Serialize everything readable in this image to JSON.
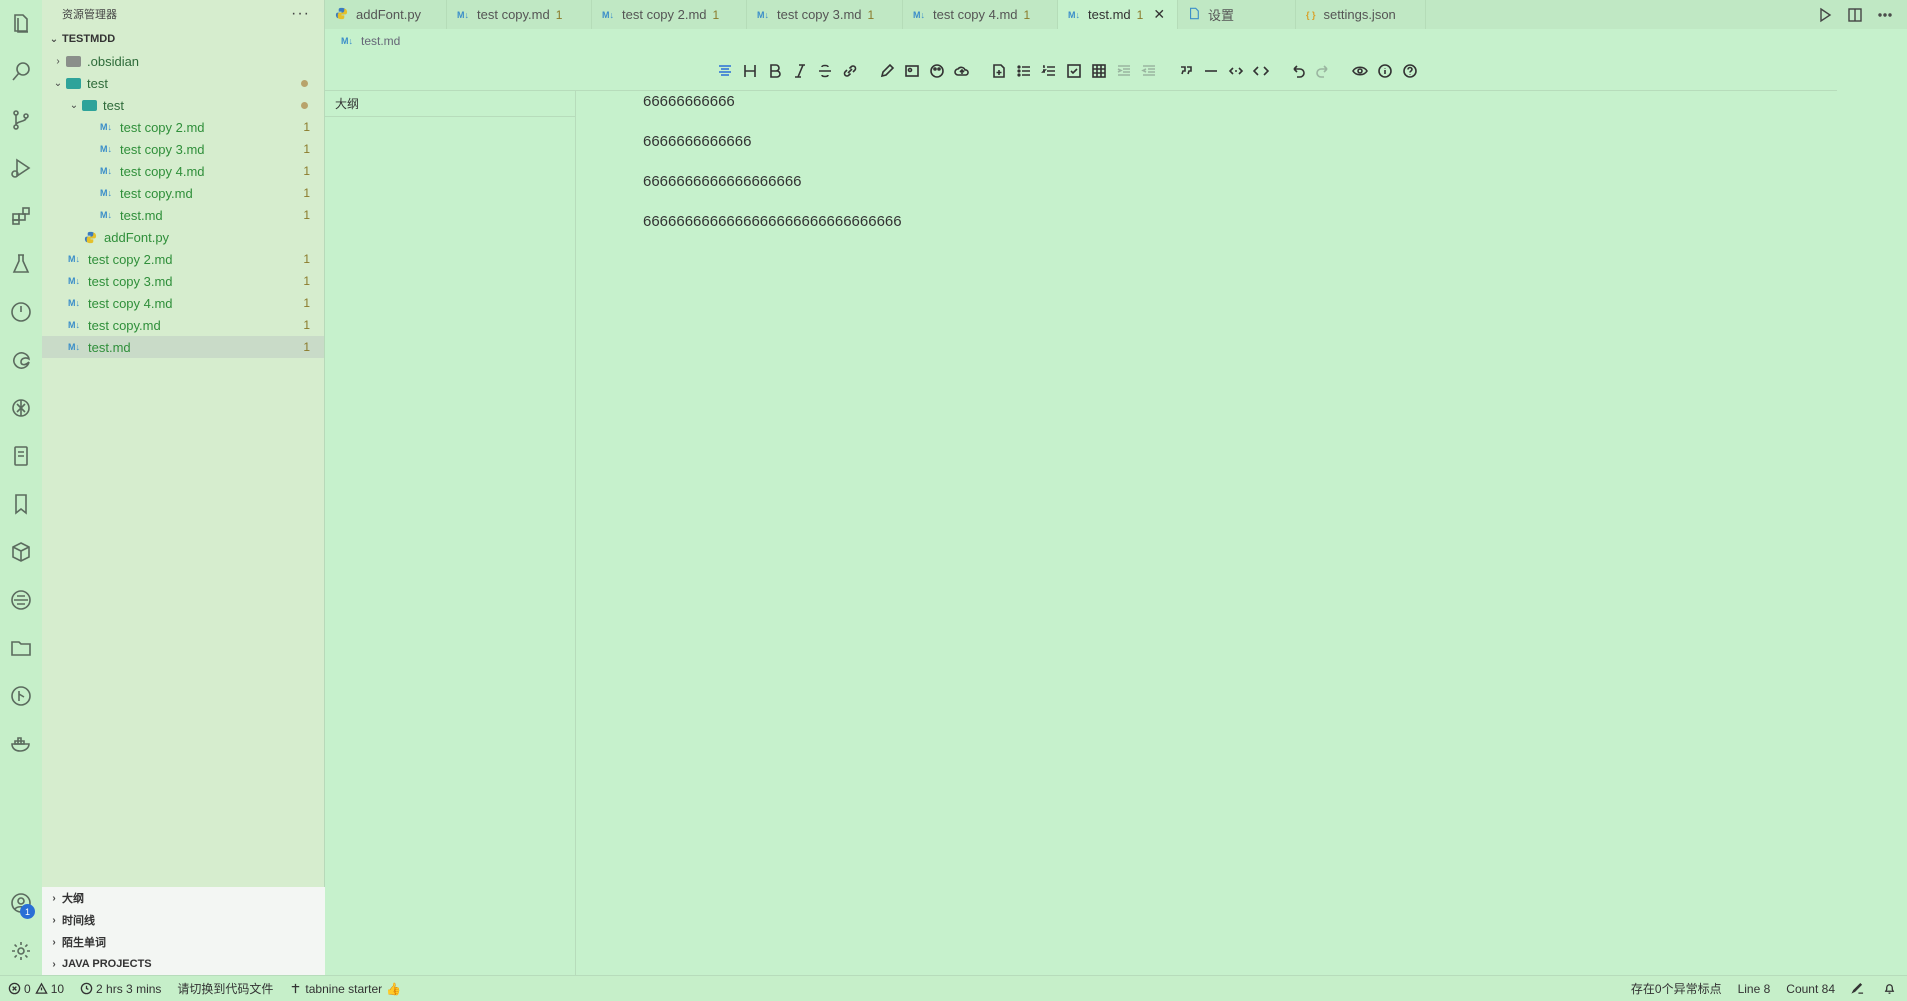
{
  "activity_bar": {
    "icons": [
      "explorer-icon",
      "search-icon",
      "source-control-icon",
      "run-debug-icon",
      "extensions-icon",
      "testing-icon",
      "power-icon",
      "edge-icon",
      "openai-icon",
      "notebook-icon",
      "bookmark-icon",
      "cube-icon",
      "remote-icon",
      "folder-icon",
      "git-graph-icon",
      "docker-icon"
    ],
    "account_badge": "1"
  },
  "sidebar": {
    "header": "资源管理器",
    "more": "···",
    "root": "TESTMDD",
    "tree": [
      {
        "label": ".obsidian",
        "type": "folder",
        "level": 1,
        "expanded": false,
        "count": ""
      },
      {
        "label": "test",
        "type": "folder",
        "level": 1,
        "expanded": true,
        "dot": true
      },
      {
        "label": "test",
        "type": "folder",
        "level": 2,
        "expanded": true,
        "dot": true
      },
      {
        "label": "test copy 2.md",
        "type": "md",
        "level": 3,
        "count": "1"
      },
      {
        "label": "test copy 3.md",
        "type": "md",
        "level": 3,
        "count": "1"
      },
      {
        "label": "test copy 4.md",
        "type": "md",
        "level": 3,
        "count": "1"
      },
      {
        "label": "test copy.md",
        "type": "md",
        "level": 3,
        "count": "1"
      },
      {
        "label": "test.md",
        "type": "md",
        "level": 3,
        "count": "1"
      },
      {
        "label": "addFont.py",
        "type": "py",
        "level": 2,
        "count": ""
      },
      {
        "label": "test copy 2.md",
        "type": "md",
        "level": 1,
        "count": "1"
      },
      {
        "label": "test copy 3.md",
        "type": "md",
        "level": 1,
        "count": "1"
      },
      {
        "label": "test copy 4.md",
        "type": "md",
        "level": 1,
        "count": "1"
      },
      {
        "label": "test copy.md",
        "type": "md",
        "level": 1,
        "count": "1"
      },
      {
        "label": "test.md",
        "type": "md",
        "level": 1,
        "count": "1",
        "selected": true
      }
    ],
    "panels": [
      "大纲",
      "时间线",
      "陌生单词",
      "JAVA PROJECTS"
    ]
  },
  "tabs": [
    {
      "label": "addFont.py",
      "icon": "py",
      "badge": ""
    },
    {
      "label": "test copy.md",
      "icon": "md",
      "badge": "1"
    },
    {
      "label": "test copy 2.md",
      "icon": "md",
      "badge": "1"
    },
    {
      "label": "test copy 3.md",
      "icon": "md",
      "badge": "1"
    },
    {
      "label": "test copy 4.md",
      "icon": "md",
      "badge": "1"
    },
    {
      "label": "test.md",
      "icon": "md",
      "badge": "1",
      "active": true
    },
    {
      "label": "设置",
      "icon": "file",
      "badge": ""
    },
    {
      "label": "settings.json",
      "icon": "json",
      "badge": ""
    }
  ],
  "md_icon_text": "M↓",
  "breadcrumb": "test.md",
  "outline_title": "大纲",
  "content_lines": [
    "66666666666",
    "6666666666666",
    "6666666666666666666",
    "6666666666666666666666666666666"
  ],
  "statusbar": {
    "errors": "0",
    "warnings": "10",
    "time": "2 hrs 3 mins",
    "switch": "请切换到代码文件",
    "tabnine": "tabnine starter",
    "anomalies": "存在0个异常标点",
    "line": "Line 8",
    "count": "Count 84"
  }
}
